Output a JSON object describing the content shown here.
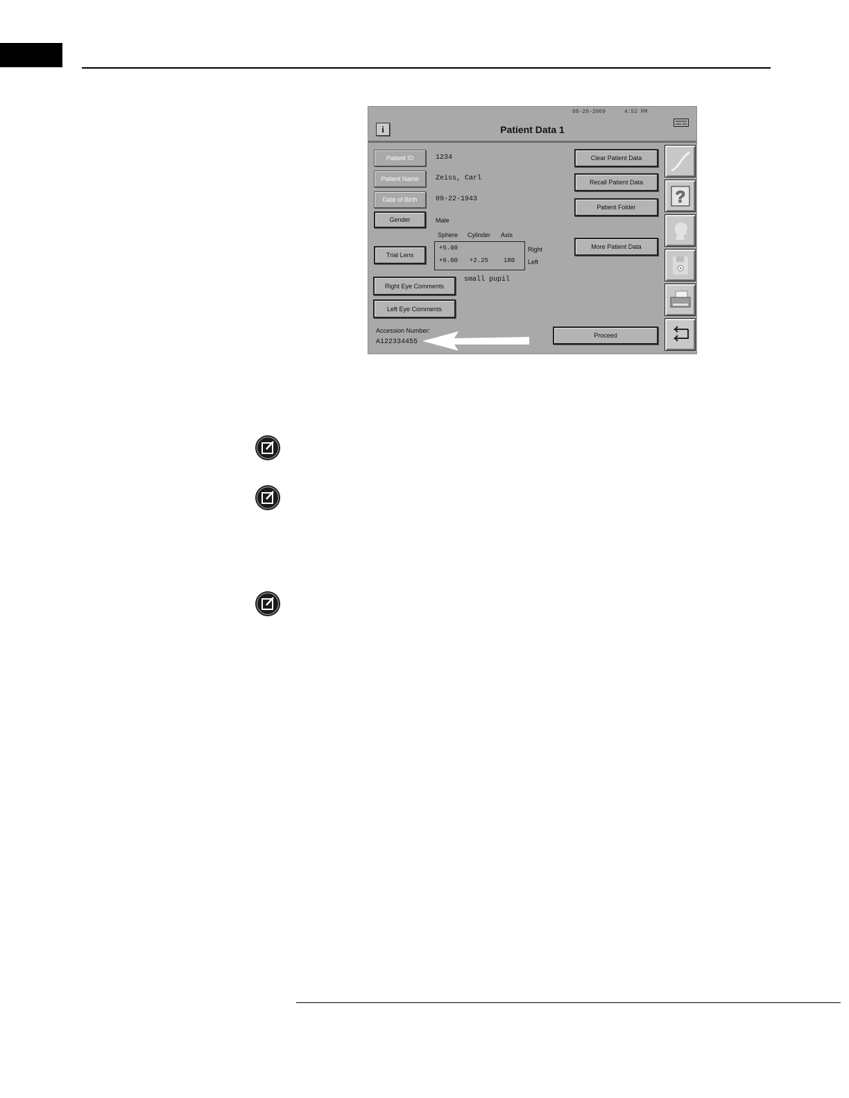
{
  "screen": {
    "date": "08-20-2009",
    "time": "4:52 PM",
    "title": "Patient Data 1",
    "info_label": "i",
    "fields": {
      "patient_id_label": "Patient ID",
      "patient_id_value": "1234",
      "patient_name_label": "Patient Name",
      "patient_name_value": "Zeiss, Carl",
      "dob_label": "Date of Birth",
      "dob_value": "09-22-1943",
      "gender_label": "Gender",
      "gender_value": "Male"
    },
    "trial_lens": {
      "button_label": "Trial Lens",
      "headers": [
        "Sphere",
        "Cylinder",
        "Axis"
      ],
      "right": {
        "sphere": "+5.00",
        "cylinder": "",
        "axis": "",
        "label": "Right"
      },
      "left": {
        "sphere": "+6.00",
        "cylinder": "+2.25",
        "axis": "180",
        "label": "Left"
      }
    },
    "comments": {
      "right_button": "Right Eye Comments",
      "left_button": "Left Eye Comments",
      "right_value": "small pupil"
    },
    "accession": {
      "label": "Accession Number:",
      "value": "A122334455"
    },
    "actions": {
      "clear": "Clear Patient Data",
      "recall": "Recall Patient Data",
      "folder": "Patient Folder",
      "more": "More Patient Data",
      "proceed": "Proceed"
    },
    "side_icons": [
      "curve-icon",
      "help-icon",
      "head-icon",
      "disk-icon",
      "printer-icon",
      "return-arrow-icon"
    ]
  }
}
